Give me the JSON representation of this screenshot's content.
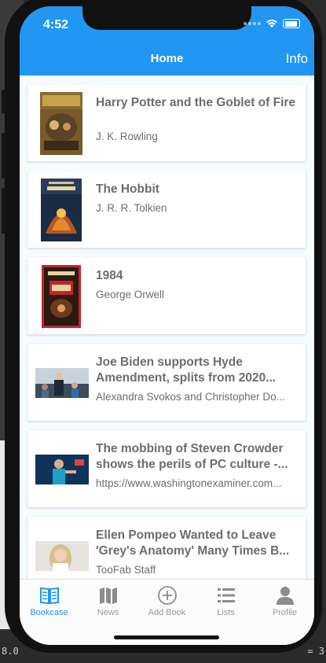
{
  "status": {
    "time": "4:52"
  },
  "header": {
    "title": "Home",
    "info_label": "Info"
  },
  "items": [
    {
      "title": "Harry Potter and the Goblet of Fire",
      "subtitle": "J. K. Rowling",
      "thumb": "book-cover-harry-potter"
    },
    {
      "title": "The Hobbit",
      "subtitle": "J. R. R. Tolkien",
      "thumb": "book-cover-hobbit"
    },
    {
      "title": "1984",
      "subtitle": "George Orwell",
      "thumb": "book-cover-1984"
    },
    {
      "title": "Joe Biden supports Hyde Amendment, splits from 2020...",
      "subtitle": "Alexandra Svokos and Christopher Do...",
      "thumb": "news-photo-biden"
    },
    {
      "title": "The mobbing of Steven Crowder shows the perils of PC culture -...",
      "subtitle": "https://www.washingtonexaminer.com...",
      "thumb": "news-photo-crowder"
    },
    {
      "title": "Ellen Pompeo Wanted to Leave 'Grey's Anatomy' Many Times B...",
      "subtitle": "TooFab Staff",
      "thumb": "news-photo-pompeo"
    }
  ],
  "tabs": [
    {
      "label": "Bookcase",
      "icon": "book-open-icon",
      "active": true
    },
    {
      "label": "News",
      "icon": "map-icon",
      "active": false
    },
    {
      "label": "Add Book",
      "icon": "plus-circle-icon",
      "active": false
    },
    {
      "label": "Lists",
      "icon": "list-icon",
      "active": false
    },
    {
      "label": "Profile",
      "icon": "person-icon",
      "active": false
    }
  ],
  "colors": {
    "accent": "#2196F3",
    "text": "#6d6d6d",
    "inactive_tab": "#9a9a9a"
  },
  "background": {
    "left_text": "8.0",
    "right_text": "= 3"
  }
}
